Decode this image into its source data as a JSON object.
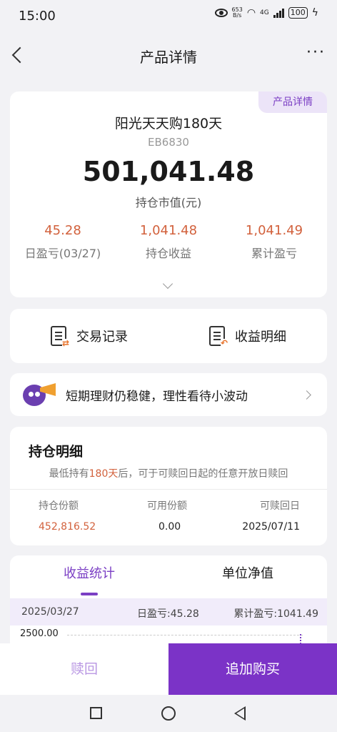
{
  "status": {
    "time": "15:00",
    "net_speed_top": "653",
    "net_speed_bottom": "B/s",
    "network": "4G",
    "battery": "100"
  },
  "nav": {
    "title": "产品详情",
    "more": "···"
  },
  "product": {
    "tag": "产品详情",
    "name": "阳光天天购180天",
    "code": "EB6830",
    "market_value": "501,041.48",
    "market_value_label": "持仓市值(元)",
    "stats": [
      {
        "value": "45.28",
        "label": "日盈亏(03/27)"
      },
      {
        "value": "1,041.48",
        "label": "持仓收益"
      },
      {
        "value": "1,041.49",
        "label": "累计盈亏"
      }
    ]
  },
  "actions": {
    "transactions": "交易记录",
    "income_detail": "收益明细"
  },
  "banner": {
    "text": "短期理财仍稳健，理性看待小波动"
  },
  "holding": {
    "title": "持仓明细",
    "note_prefix": "最低持有",
    "note_highlight": "180天",
    "note_suffix": "后，可于可赎回日起的任意开放日赎回",
    "columns": [
      "持仓份额",
      "可用份额",
      "可赎回日"
    ],
    "values": [
      "452,816.52",
      "0.00",
      "2025/07/11"
    ]
  },
  "income": {
    "tabs": [
      "收益统计",
      "单位净值"
    ],
    "date": "2025/03/27",
    "daily": "日盈亏:45.28",
    "cumulative": "累计盈亏:1041.49",
    "y_top": "2500.00"
  },
  "bottom": {
    "redeem": "赎回",
    "buy": "追加购买"
  },
  "colors": {
    "accent": "#7b33c7",
    "gain": "#d2613c"
  }
}
